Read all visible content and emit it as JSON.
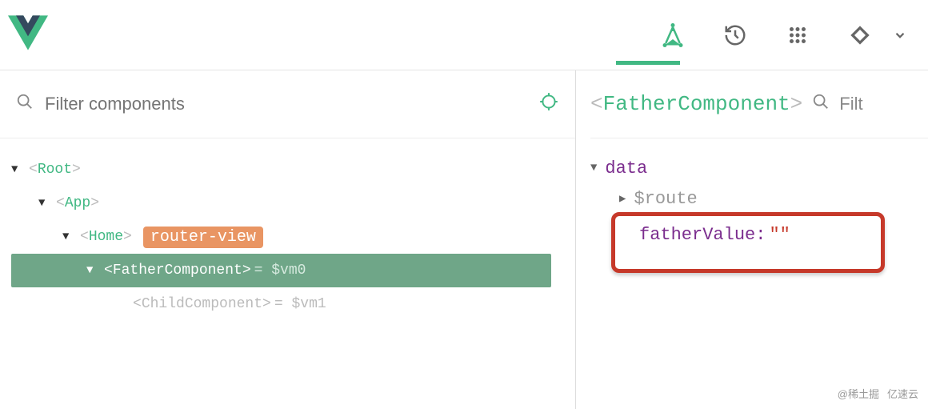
{
  "header": {
    "active_tab": 0,
    "icons": [
      "components-icon",
      "history-icon",
      "vuex-icon",
      "routes-icon"
    ],
    "menu_icon": "chevron-down-icon"
  },
  "filter": {
    "placeholder": "Filter components"
  },
  "tree": [
    {
      "name": "Root",
      "indent": 0,
      "hasCaret": true,
      "selected": false
    },
    {
      "name": "App",
      "indent": 1,
      "hasCaret": true,
      "selected": false
    },
    {
      "name": "Home",
      "indent": 2,
      "hasCaret": true,
      "selected": false,
      "badge": "router-view"
    },
    {
      "name": "FatherComponent",
      "indent": 3,
      "hasCaret": true,
      "selected": true,
      "vmref": "= $vm0"
    },
    {
      "name": "ChildComponent",
      "indent": 4,
      "hasCaret": false,
      "selected": false,
      "vmref": "= $vm1"
    }
  ],
  "inspector": {
    "selected_component": "FatherComponent",
    "filter_placeholder": "Filt",
    "data_section_label": "data",
    "props": [
      {
        "name": "$route",
        "type": "ref"
      },
      {
        "name": "fatherValue",
        "value": "\"\"",
        "highlighted": true
      }
    ]
  },
  "watermark": {
    "left": "@稀土掘",
    "right": "亿速云"
  }
}
